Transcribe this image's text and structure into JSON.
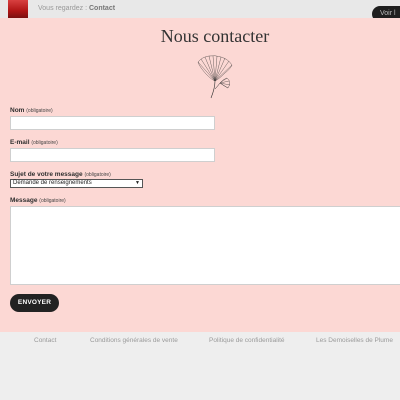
{
  "notification": {
    "prefix": "Vous regardez :",
    "page": "Contact",
    "button_label": "Voir l"
  },
  "modal": {
    "title": "Nous contacter",
    "logo_icon": "ginkgo-leaf-icon",
    "required_note": "(obligatoire)",
    "fields": {
      "name_label": "Nom",
      "email_label": "E-mail",
      "subject_label": "Sujet de votre message",
      "subject_value": "Demande de renseignements",
      "message_label": "Message"
    },
    "submit_label": "ENVOYER"
  },
  "footer": {
    "links": [
      "Contact",
      "Conditions générales de vente",
      "Politique de confidentialité",
      "Les Demoiselles de Plume"
    ]
  },
  "colors": {
    "modal_bg": "#fcd8d4",
    "page_bg": "#eeeeee",
    "button_bg": "#222222"
  }
}
